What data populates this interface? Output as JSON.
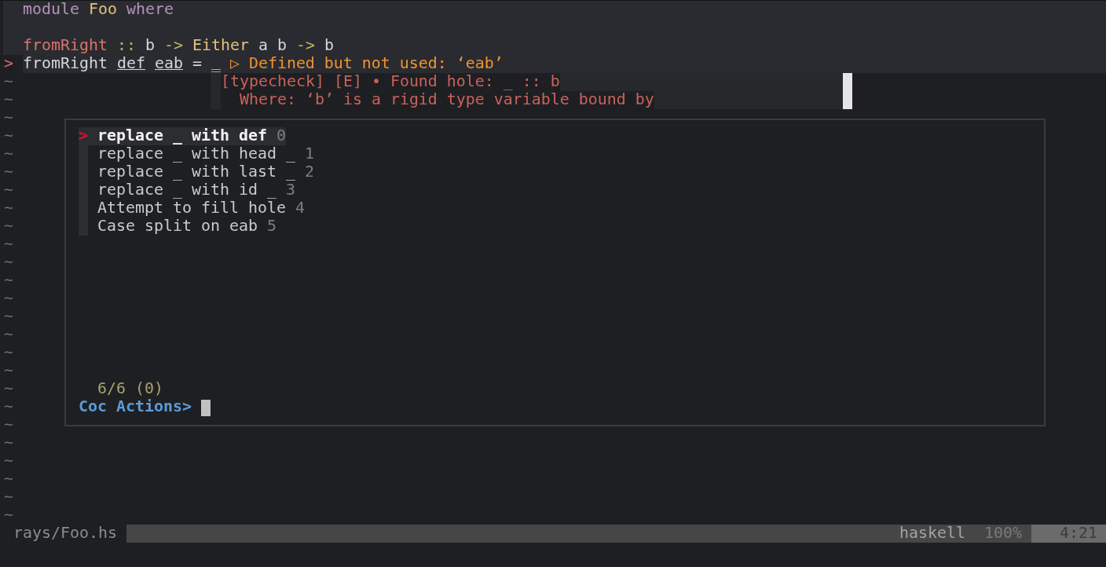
{
  "editor": {
    "lines": [
      {
        "kind": "code",
        "tokens": [
          {
            "text": "module",
            "kind": "keyword"
          },
          {
            "text": "Foo",
            "kind": "type"
          },
          {
            "text": "where",
            "kind": "keyword"
          }
        ]
      },
      {
        "kind": "blank"
      },
      {
        "kind": "code",
        "tokens": [
          {
            "text": "fromRight",
            "kind": "function"
          },
          {
            "text": "::",
            "kind": "operator"
          },
          {
            "text": "b",
            "kind": "plain"
          },
          {
            "text": "->",
            "kind": "operator"
          },
          {
            "text": "Either",
            "kind": "type"
          },
          {
            "text": "a",
            "kind": "plain"
          },
          {
            "text": "b",
            "kind": "plain"
          },
          {
            "text": "->",
            "kind": "operator"
          },
          {
            "text": "b",
            "kind": "plain"
          }
        ]
      },
      {
        "kind": "code",
        "sign": ">",
        "tokens": [
          {
            "text": "fromRight",
            "kind": "plain"
          },
          {
            "text": "def",
            "kind": "unused"
          },
          {
            "text": "eab",
            "kind": "unused"
          },
          {
            "text": "=",
            "kind": "plain"
          },
          {
            "text": "_",
            "kind": "hole"
          }
        ],
        "virtual_text": "▷ Defined but not used: ‘eab’"
      }
    ],
    "filler_lines": [
      "~",
      "~",
      "~",
      "~",
      "~",
      "~",
      "~",
      "~",
      "~",
      "~",
      "~",
      "~",
      "~",
      "~",
      "~",
      "~",
      "~",
      "~",
      "~",
      "~",
      "~",
      "~",
      "~",
      "~",
      "~"
    ]
  },
  "hover": {
    "lines": [
      "[typecheck] [E] • Found hole: _ :: b",
      "  Where: ‘b’ is a rigid type variable bound by"
    ]
  },
  "action_list": {
    "marker": ">",
    "items": [
      {
        "label": "replace _ with def",
        "shortcut": "0",
        "selected": true
      },
      {
        "label": "replace _ with head _",
        "shortcut": "1",
        "selected": false
      },
      {
        "label": "replace _ with last _",
        "shortcut": "2",
        "selected": false
      },
      {
        "label": "replace _ with id _",
        "shortcut": "3",
        "selected": false
      },
      {
        "label": "Attempt to fill hole",
        "shortcut": "4",
        "selected": false
      },
      {
        "label": "Case split on eab",
        "shortcut": "5",
        "selected": false
      }
    ],
    "count": "6/6 (0)",
    "prompt": "Coc Actions>"
  },
  "status_line": {
    "file": "rays/Foo.hs",
    "filetype": "haskell",
    "percent": "100%",
    "position": "4:21"
  }
}
